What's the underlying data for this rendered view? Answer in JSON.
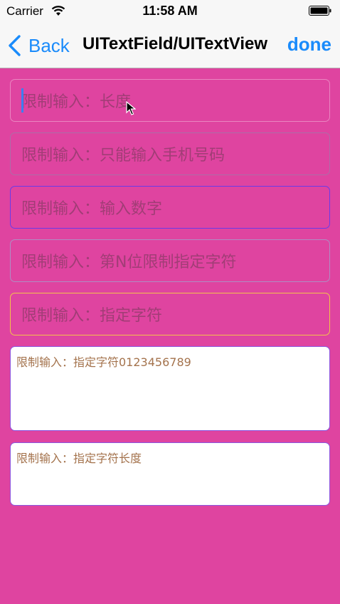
{
  "status_bar": {
    "carrier": "Carrier",
    "time": "11:58 AM",
    "wifi_icon": "wifi-icon",
    "battery_icon": "battery-icon"
  },
  "nav": {
    "back_label": "Back",
    "back_icon": "chevron-left-icon",
    "title": "UITextField/UITextView",
    "done_label": "done",
    "accent_color": "#1A8BFB"
  },
  "fields": [
    {
      "placeholder": "限制输入：长度",
      "focused": true
    },
    {
      "placeholder": "限制输入：只能输入手机号码"
    },
    {
      "placeholder": "限制输入：输入数字"
    },
    {
      "placeholder": "限制输入：第N位限制指定字符"
    },
    {
      "placeholder": "限制输入：指定字符"
    }
  ],
  "text_views": [
    {
      "text": "限制输入：指定字符0123456789"
    },
    {
      "text": "限制输入：指定字符长度"
    }
  ],
  "colors": {
    "background": "#DF44A0",
    "placeholder_text": "#963C6E",
    "textview_text": "#A4734D"
  }
}
